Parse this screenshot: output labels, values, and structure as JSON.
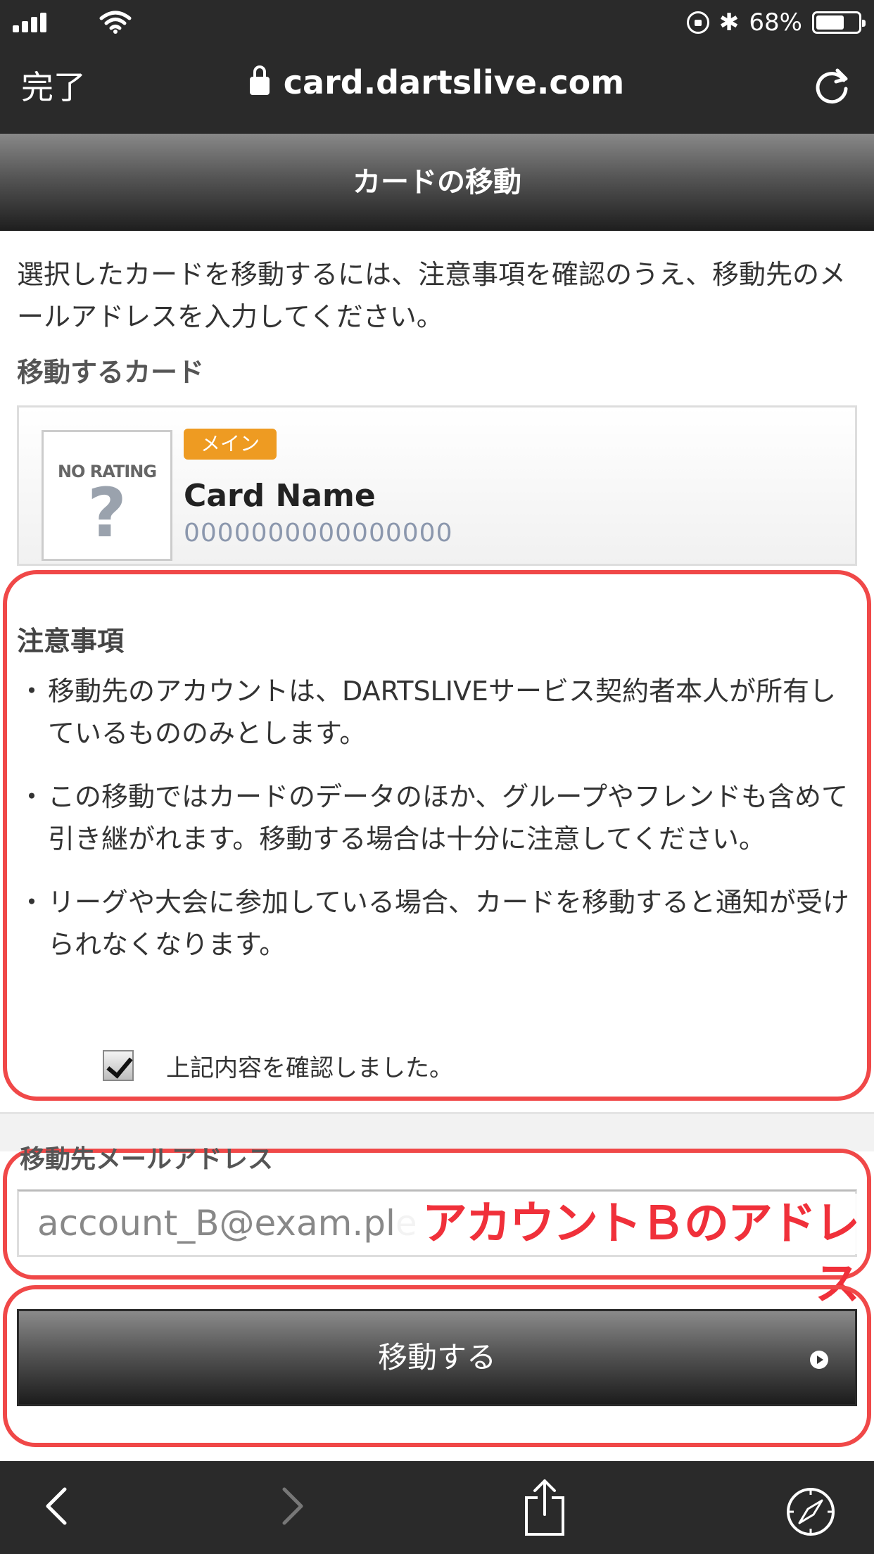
{
  "status_bar": {
    "battery": "68%",
    "battery_level": 0.68
  },
  "browser": {
    "done_label": "完了",
    "url": "card.dartslive.com"
  },
  "page": {
    "title": "カードの移動",
    "intro": "選択したカードを移動するには、注意事項を確認のうえ、移動先のメールアドレスを入力してください。",
    "section_label": "移動するカード"
  },
  "card": {
    "no_rating": "NO RATING",
    "no_rating_mark": "?",
    "badge": "メイン",
    "name": "Card Name",
    "number": "0000000000000000"
  },
  "caution": {
    "title": "注意事項",
    "items": [
      "移動先のアカウントは、DARTSLIVEサービス契約者本人が所有しているもののみとします。",
      "この移動ではカードのデータのほか、グループやフレンドも含めて引き継がれます。移動する場合は十分に注意してください。",
      "リーグや大会に参加している場合、カードを移動すると通知が受けられなくなります。"
    ],
    "confirm_label": "上記内容を確認しました。",
    "confirm_checked": true
  },
  "email": {
    "label": "移動先メールアドレス",
    "value": "account_B@exam.ple",
    "annotation": "アカウントＢのアドレス"
  },
  "submit": {
    "label": "移動する"
  },
  "colors": {
    "highlight": "#f04848",
    "badge": "#ee9b22",
    "chrome": "#2a2a2a"
  }
}
